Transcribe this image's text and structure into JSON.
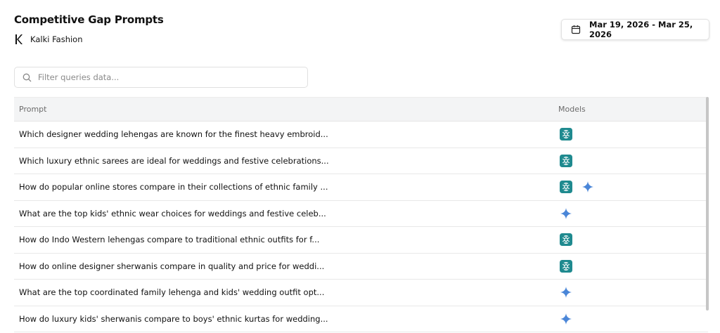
{
  "header": {
    "title": "Competitive Gap Prompts",
    "brand_name": "Kalki Fashion",
    "date_range": "Mar 19, 2026 - Mar 25, 2026"
  },
  "search": {
    "placeholder": "Filter queries data...",
    "value": ""
  },
  "table": {
    "columns": [
      "Prompt",
      "Models"
    ],
    "rows": [
      {
        "prompt": "Which designer wedding lehengas are known for the finest heavy embroid...",
        "models": [
          "openai-icon"
        ]
      },
      {
        "prompt": "Which luxury ethnic sarees are ideal for weddings and festive celebrations...",
        "models": [
          "openai-icon"
        ]
      },
      {
        "prompt": "How do popular online stores compare in their collections of ethnic family ...",
        "models": [
          "openai-icon",
          "gemini-icon"
        ]
      },
      {
        "prompt": "What are the top kids' ethnic wear choices for weddings and festive celeb...",
        "models": [
          "gemini-icon"
        ]
      },
      {
        "prompt": "How do Indo Western lehengas compare to traditional ethnic outfits for f...",
        "models": [
          "openai-icon"
        ]
      },
      {
        "prompt": "How do online designer sherwanis compare in quality and price for weddi...",
        "models": [
          "openai-icon"
        ]
      },
      {
        "prompt": "What are the top coordinated family lehenga and kids' wedding outfit opt...",
        "models": [
          "gemini-icon"
        ]
      },
      {
        "prompt": "How do luxury kids' sherwanis compare to boys' ethnic kurtas for wedding...",
        "models": [
          "gemini-icon"
        ]
      }
    ]
  },
  "colors": {
    "openai_badge": "#1f8a8f",
    "gemini_star": "#4a86d8",
    "header_bg": "#f3f4f5"
  }
}
